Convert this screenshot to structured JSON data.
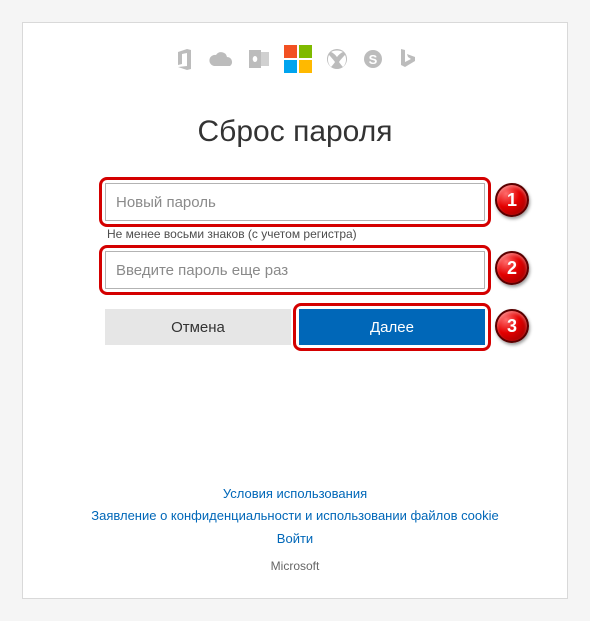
{
  "brand_icons": [
    "office-icon",
    "onedrive-icon",
    "outlook-icon",
    "microsoft-logo",
    "xbox-icon",
    "skype-icon",
    "bing-icon"
  ],
  "title": "Сброс пароля",
  "form": {
    "new_password_placeholder": "Новый пароль",
    "hint": "Не менее восьми знаков (с учетом регистра)",
    "confirm_password_placeholder": "Введите пароль еще раз",
    "cancel_label": "Отмена",
    "next_label": "Далее"
  },
  "annotations": {
    "badge1": "1",
    "badge2": "2",
    "badge3": "3"
  },
  "footer": {
    "terms": "Условия использования",
    "privacy": "Заявление о конфиденциальности и использовании файлов cookie",
    "signin": "Войти",
    "trademark": "Microsoft"
  },
  "colors": {
    "accent": "#0067b8",
    "highlight": "#d40000"
  }
}
